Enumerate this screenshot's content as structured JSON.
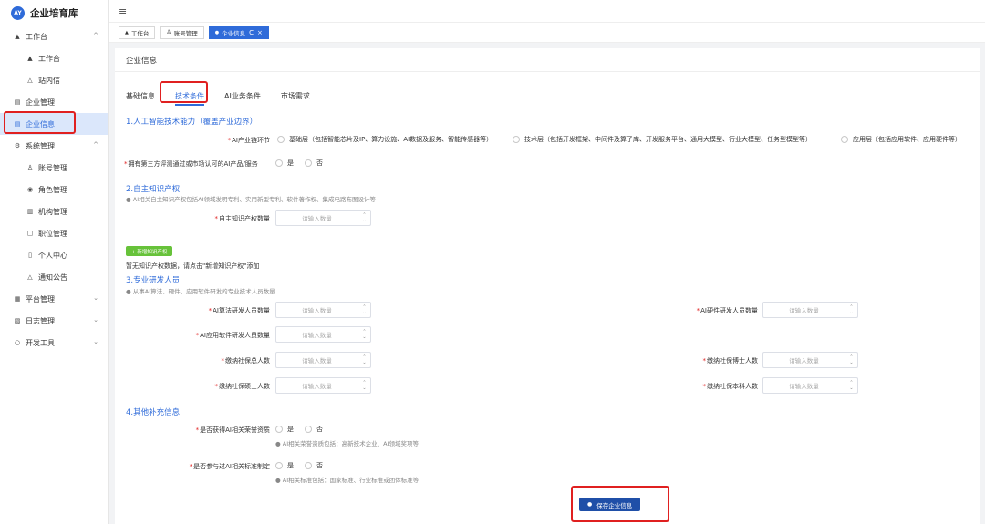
{
  "brand": {
    "logo_text": "AY",
    "title": "企业培育库"
  },
  "sidebar": {
    "items": [
      {
        "label": "工作台",
        "icon": "home-icon",
        "glyph": "▲",
        "level": 1,
        "chevron": "^"
      },
      {
        "label": "工作台",
        "icon": "home-icon",
        "glyph": "▲",
        "level": 2
      },
      {
        "label": "站内信",
        "icon": "bell-icon",
        "glyph": "△",
        "level": 2
      },
      {
        "label": "企业管理",
        "icon": "building-icon",
        "glyph": "▤",
        "level": 1
      },
      {
        "label": "企业信息",
        "icon": "building-icon",
        "glyph": "▤",
        "level": 1,
        "active": true
      },
      {
        "label": "系统管理",
        "icon": "gear-icon",
        "glyph": "⚙",
        "level": 1,
        "chevron": "^"
      },
      {
        "label": "账号管理",
        "icon": "user-icon",
        "glyph": "♙",
        "level": 2
      },
      {
        "label": "角色管理",
        "icon": "role-icon",
        "glyph": "◉",
        "level": 2
      },
      {
        "label": "机构管理",
        "icon": "org-icon",
        "glyph": "▥",
        "level": 2
      },
      {
        "label": "职位管理",
        "icon": "position-icon",
        "glyph": "▢",
        "level": 2
      },
      {
        "label": "个人中心",
        "icon": "profile-icon",
        "glyph": "▯",
        "level": 2
      },
      {
        "label": "通知公告",
        "icon": "notice-icon",
        "glyph": "△",
        "level": 2
      },
      {
        "label": "平台管理",
        "icon": "grid-icon",
        "glyph": "▦",
        "level": 1,
        "chevron": "⌄"
      },
      {
        "label": "日志管理",
        "icon": "log-icon",
        "glyph": "▧",
        "level": 1,
        "chevron": "⌄"
      },
      {
        "label": "开发工具",
        "icon": "tool-icon",
        "glyph": "○",
        "level": 1,
        "chevron": "⌄"
      }
    ]
  },
  "topbar": {
    "menu_icon": "≡"
  },
  "tabs": [
    {
      "label": "工作台",
      "glyph": "▲"
    },
    {
      "label": "账号管理",
      "glyph": "♙"
    },
    {
      "label": "企业信息",
      "glyph": "●",
      "active": true,
      "refresh": "C",
      "close": "×"
    }
  ],
  "panel": {
    "title": "企业信息",
    "subtabs": [
      "基础信息",
      "技术条件",
      "AI业务条件",
      "市场需求"
    ],
    "active_subtab": "技术条件"
  },
  "section1": {
    "title": "1.人工智能技术能力（覆盖产业边界）",
    "chain_label": "AI产业链环节",
    "chain_options": [
      "基础层（包括智能芯片及IP、算力设施、AI数据及服务、智能传感器等）",
      "技术层（包括开发框架、中间件及算子库、开发服务平台、通用大模型、行业大模型、任务型模型等）",
      "应用层（包括应用软件、应用硬件等）"
    ],
    "eval_label": "拥有第三方评测通过或市场认可的AI产品/服务",
    "eval_options": [
      "是",
      "否"
    ]
  },
  "section2": {
    "title": "2.自主知识产权",
    "hint": "AI相关自主知识产权包括AI领域发明专利、实用新型专利、软件著作权、集成电路布图设计等",
    "count_label": "自主知识产权数量",
    "placeholder": "请输入数量",
    "add_button": "+ 新增知识产权",
    "empty_text": "暂无知识产权数据，请点击\"新增知识产权\"添加"
  },
  "section3": {
    "title": "3.专业研发人员",
    "hint": "从事AI算法、硬件、应用软件研发的专业技术人员数量",
    "placeholder": "请输入数量",
    "left_fields": [
      "AI算法研发人员数量",
      "AI应用软件研发人员数量",
      "缴纳社保总人数",
      "缴纳社保硕士人数"
    ],
    "right_fields": [
      "AI硬件研发人员数量",
      "缴纳社保博士人数",
      "缴纳社保本科人数"
    ]
  },
  "section4": {
    "title": "4.其他补充信息",
    "q1_label": "是否获得AI相关荣誉资质",
    "q1_hint": "AI相关荣誉资质包括：高新技术企业、AI领域奖项等",
    "q2_label": "是否参与过AI相关标准制定",
    "q2_hint": "AI相关标准包括：国家标准、行业标准或团体标准等",
    "options": [
      "是",
      "否"
    ]
  },
  "save_button": "保存企业信息",
  "colors": {
    "primary": "#2f6bd9",
    "highlight": "#e02020",
    "success": "#67c23a",
    "save": "#1f4fa8"
  }
}
